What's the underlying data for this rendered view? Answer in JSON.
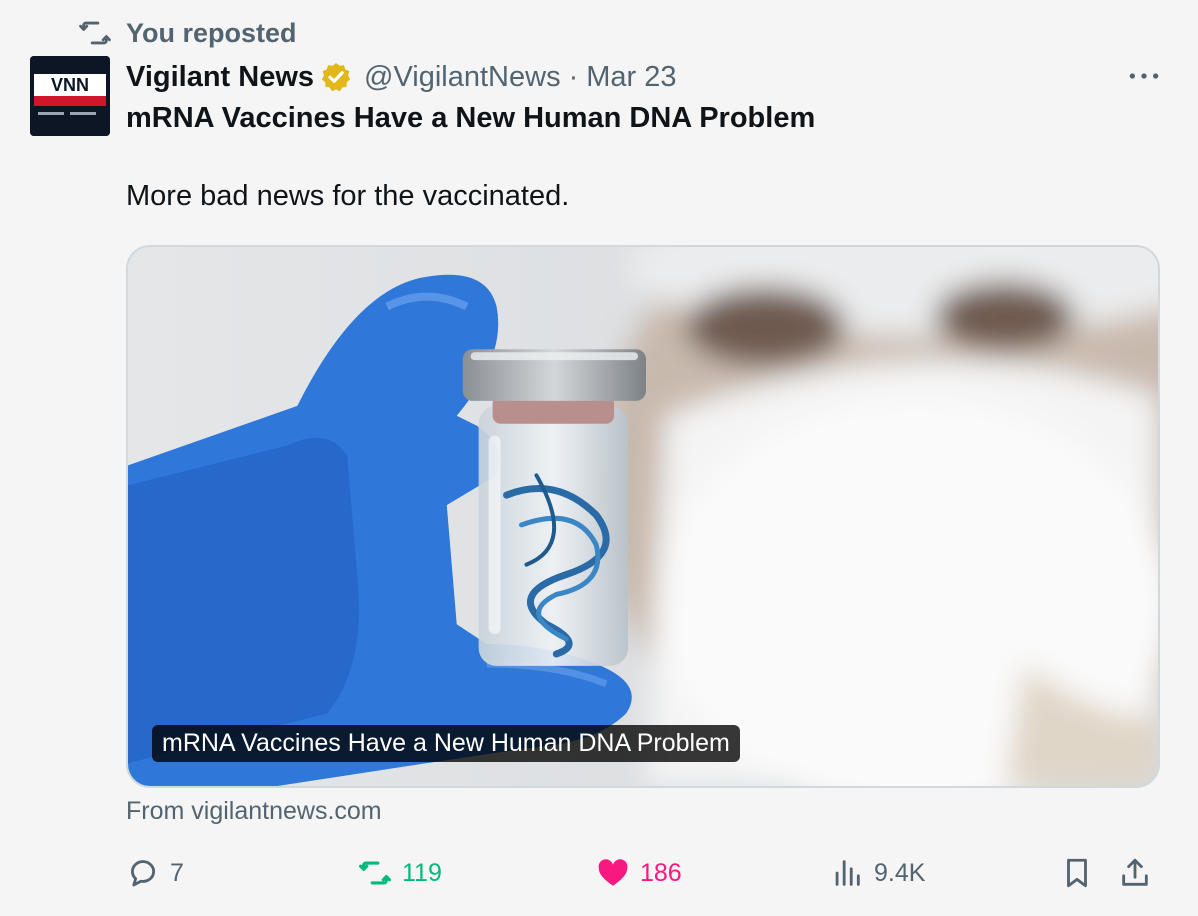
{
  "repost_banner": {
    "text": "You reposted",
    "icon": "repost-icon"
  },
  "author": {
    "avatar_text": "VNN",
    "name": "Vigilant News",
    "verified": true,
    "handle": "@VigilantNews",
    "separator": "·",
    "date": "Mar 23"
  },
  "post": {
    "title": "mRNA Vaccines Have a New Human DNA Problem",
    "text": "More bad news for the vaccinated."
  },
  "link_card": {
    "caption": "mRNA Vaccines Have a New Human DNA Problem",
    "source": "From vigilantnews.com"
  },
  "actions": {
    "replies": "7",
    "reposts": "119",
    "likes": "186",
    "views": "9.4K"
  },
  "colors": {
    "repost_green": "#00ba7c",
    "like_pink": "#f91880",
    "muted": "#536471",
    "verified_gold": "#e2b719"
  }
}
